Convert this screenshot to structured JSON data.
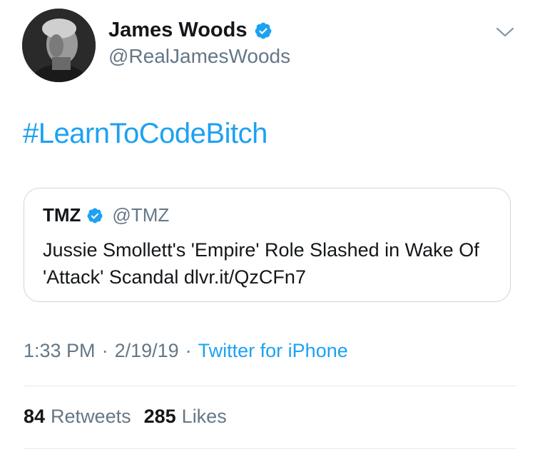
{
  "author": {
    "name": "James Woods",
    "handle": "@RealJamesWoods",
    "verified": true
  },
  "tweet": {
    "text": "#LearnToCodeBitch"
  },
  "quoted_tweet": {
    "name": "TMZ",
    "handle": "@TMZ",
    "verified": true,
    "text": "Jussie Smollett's 'Empire' Role Slashed in Wake Of 'Attack' Scandal dlvr.it/QzCFn7"
  },
  "meta": {
    "time": "1:33 PM",
    "separator": "·",
    "date": "2/19/19",
    "source": "Twitter for iPhone"
  },
  "stats": {
    "retweets_count": "84",
    "retweets_label": "Retweets",
    "likes_count": "285",
    "likes_label": "Likes"
  },
  "colors": {
    "link": "#1da1f2",
    "secondary_text": "#657786",
    "border": "#ccd6dd",
    "verified_badge": "#1da1f2"
  },
  "icons": {
    "verified": "verified-badge-icon",
    "more": "chevron-down-icon"
  }
}
